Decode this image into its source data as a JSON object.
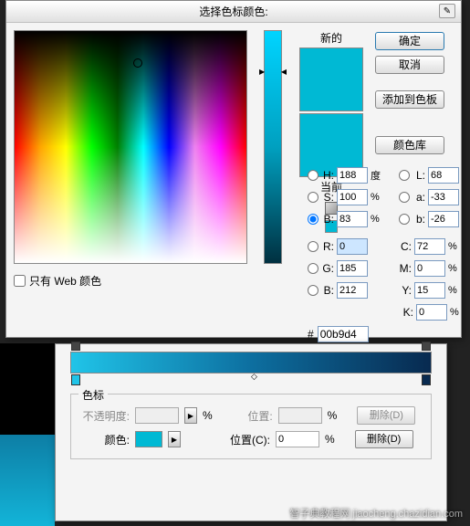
{
  "color_dialog": {
    "title": "选择色标颜色:",
    "new_label": "新的",
    "current_label": "当前",
    "buttons": {
      "ok": "确定",
      "cancel": "取消",
      "add_swatch": "添加到色板",
      "color_lib": "颜色库"
    },
    "hsb": {
      "h_label": "H:",
      "h_value": "188",
      "h_unit": "度",
      "s_label": "S:",
      "s_value": "100",
      "s_unit": "%",
      "b_label": "B:",
      "b_value": "83",
      "b_unit": "%"
    },
    "lab": {
      "l_label": "L:",
      "l_value": "68",
      "a_label": "a:",
      "a_value": "-33",
      "b_label": "b:",
      "b_value": "-26"
    },
    "rgb": {
      "r_label": "R:",
      "r_value": "0",
      "g_label": "G:",
      "g_value": "185",
      "b_label": "B:",
      "b_value": "212"
    },
    "cmyk": {
      "c_label": "C:",
      "c_value": "72",
      "unit": "%",
      "m_label": "M:",
      "m_value": "0",
      "y_label": "Y:",
      "y_value": "15",
      "k_label": "K:",
      "k_value": "0"
    },
    "hex_prefix": "#",
    "hex_value": "00b9d4",
    "web_only": "只有 Web 颜色",
    "preview_color": "#00b9d4"
  },
  "gradient_dialog": {
    "stops_label": "色标",
    "opacity_label": "不透明度:",
    "color_label": "颜色:",
    "position_label": "位置:",
    "position_label2": "位置(C):",
    "position_value": "0",
    "percent": "%",
    "delete_btn": "删除(D)",
    "swatch_color": "#00b9d4"
  },
  "watermark": "智子典教程网 jiaocheng.chazidian.com"
}
